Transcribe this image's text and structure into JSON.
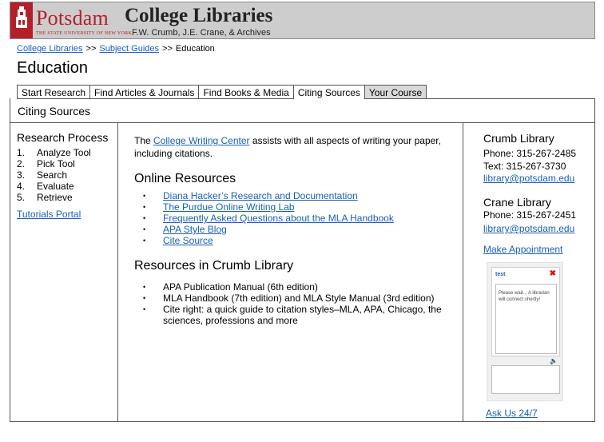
{
  "header": {
    "logo_word": "Potsdam",
    "logo_sub": "THE STATE UNIVERSITY OF NEW YORK",
    "logo_year": "1816",
    "title": "College Libraries",
    "subtitle": "F.W. Crumb, J.E. Crane, & Archives",
    "brand_color": "#b3202a"
  },
  "breadcrumb": {
    "items": [
      "College Libraries",
      "Subject Guides"
    ],
    "separator": ">>",
    "current": "Education"
  },
  "page_title": "Education",
  "tabs": [
    {
      "label": "Start Research"
    },
    {
      "label": "Find Articles & Journals"
    },
    {
      "label": "Find Books & Media"
    },
    {
      "label": "Citing Sources"
    },
    {
      "label": "Your Course"
    }
  ],
  "section_title": "Citing Sources",
  "left": {
    "heading": "Research Process",
    "steps": [
      {
        "num": "1.",
        "label": "Analyze Tool"
      },
      {
        "num": "2.",
        "label": "Pick Tool"
      },
      {
        "num": "3.",
        "label": "Search"
      },
      {
        "num": "4.",
        "label": "Evaluate"
      },
      {
        "num": "5.",
        "label": "Retrieve"
      }
    ],
    "tutorials": "Tutorials Portal"
  },
  "main": {
    "intro_pre": "The ",
    "intro_link": "College Writing Center",
    "intro_post": " assists with all aspects of writing your paper, including citations.",
    "online_heading": "Online Resources",
    "online_links": [
      "Diana Hacker’s Research and Documentation",
      "The Purdue Online Writing Lab",
      "Frequently Asked Questions about the MLA Handbook",
      "APA Style Blog",
      "Cite Source"
    ],
    "crumb_heading": "Resources in Crumb Library",
    "crumb_items": [
      "APA Publication Manual (6th edition)",
      "MLA Handbook (7th edition) and MLA Style Manual (3rd edition)",
      "Cite right: a quick guide to citation styles–MLA, APA, Chicago, the sciences, professions and more"
    ]
  },
  "right": {
    "crumb_name": "Crumb Library",
    "crumb_phone": "Phone: 315-267-2485",
    "crumb_text": "Text: 315-267-3730",
    "crumb_email": "library@potsdam.edu",
    "crane_name": "Crane Library",
    "crane_phone": "Phone: 315-267-2451",
    "crane_email": "library@potsdam.edu",
    "appointment": "Make Appointment",
    "chat": {
      "title": "test",
      "message": "Please wait... A librarian will connect shortly!"
    },
    "ask": "Ask Us 24/7"
  }
}
